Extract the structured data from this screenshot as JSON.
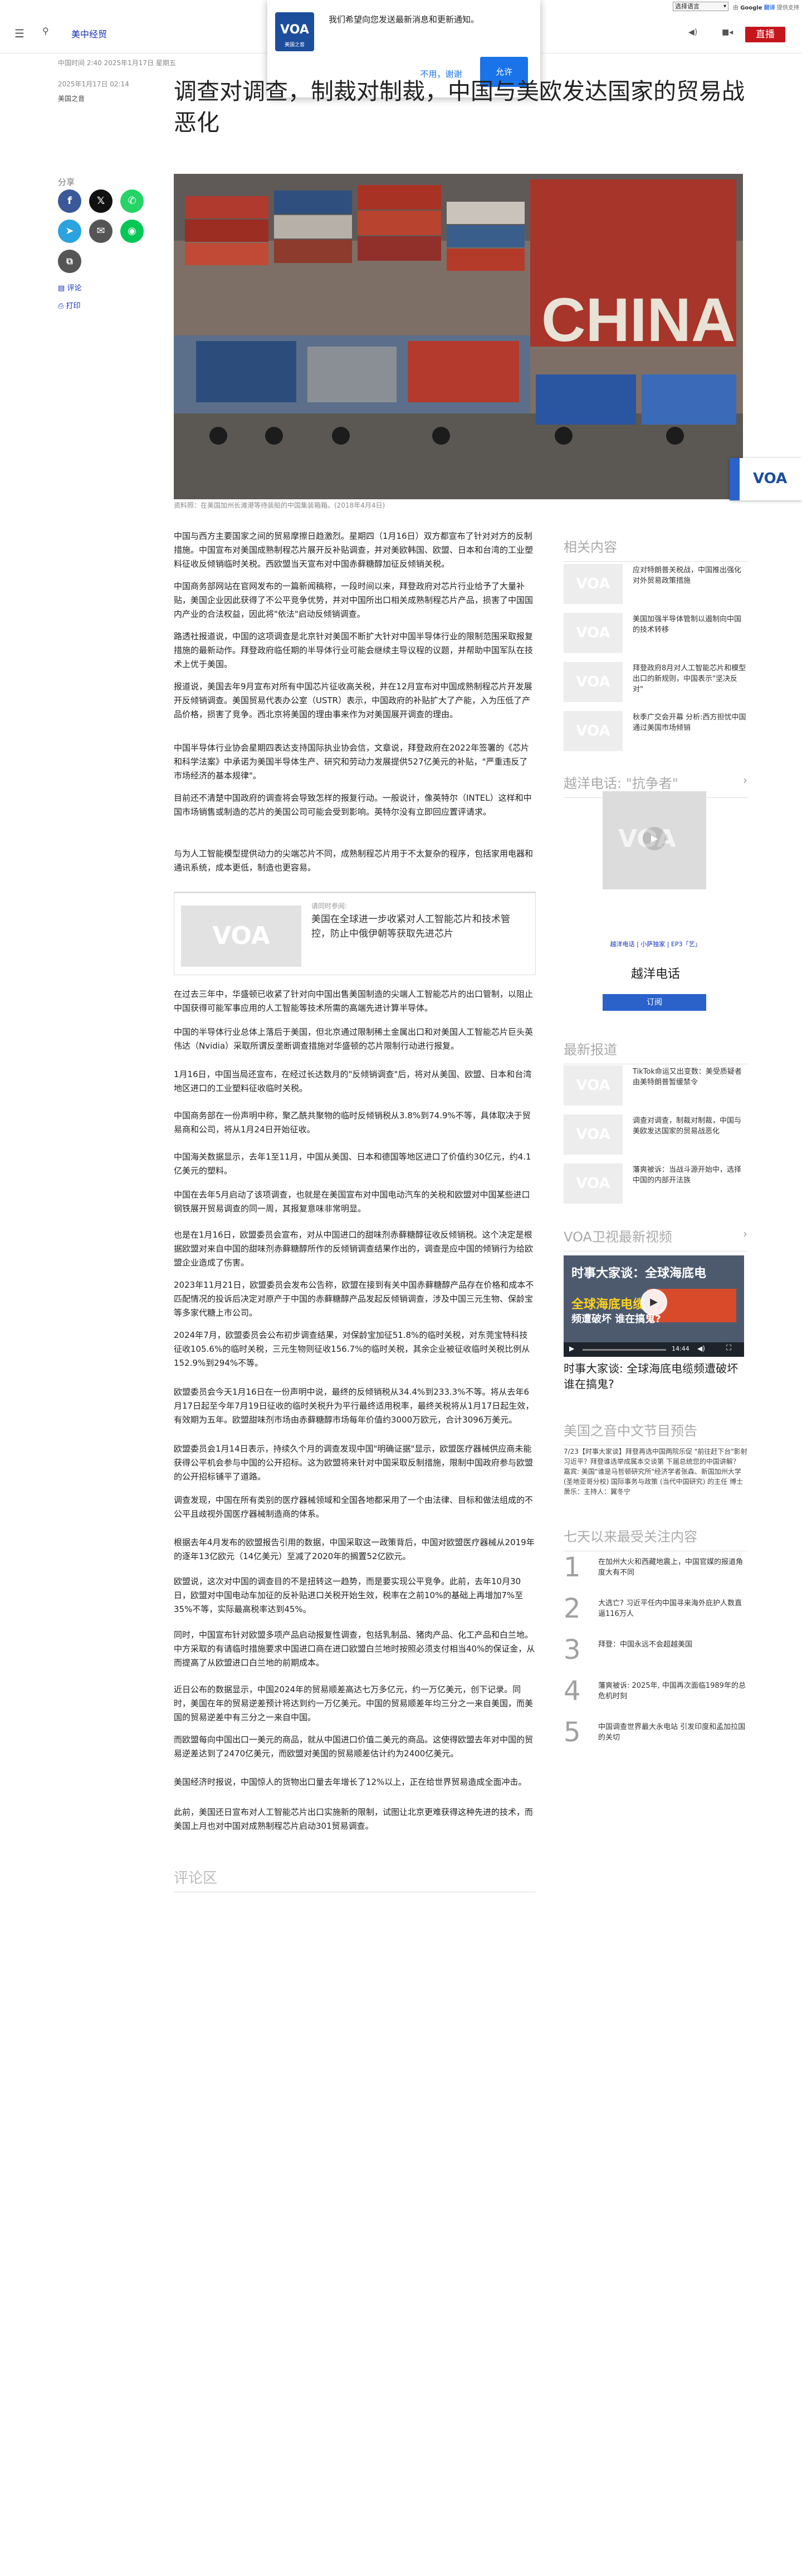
{
  "translate_bar": {
    "select_label": "选择语言",
    "powered": "由",
    "google": "Google",
    "translate": "翻译",
    "suffix": "提供支持"
  },
  "header": {
    "section": "美中经贸",
    "live": "直播"
  },
  "notification": {
    "message": "我们希望向您发送最新消息和更新通知。",
    "deny": "不用，谢谢",
    "allow": "允许",
    "logo_text": "VOA",
    "logo_sub": "美国之音"
  },
  "article": {
    "dateline": "中国时间 2:40 2025年1月17日 星期五",
    "date": "2025年1月17日 02:14",
    "author": "美国之音",
    "headline": "调查对调查，制裁对制裁，中国与美欧发达国家的贸易战恶化",
    "caption": "资料照：在美国加州长滩港等待装船的中国集装箱箱。(2018年4月4日)",
    "paragraphs": [
      "中国与西方主要国家之间的贸易摩擦日趋激烈。星期四（1月16日）双方都宣布了针对对方的反制措施。中国宣布对美国成熟制程芯片展开反补贴调查，并对美欧韩国、欧盟、日本和台湾的工业塑料征收反倾销临时关税。西欧盟当天宣布对中国赤藓糖醇加征反倾销关税。",
      "中国商务部网站在官网发布的一篇新闻稿称，一段时间以来，拜登政府对芯片行业给予了大量补贴，美国企业因此获得了不公平竞争优势，并对中国所出口相关成熟制程芯片产品，损害了中国国内产业的合法权益，因此将\"依法\"启动反倾销调查。",
      "路透社报道说，中国的这项调查是北京针对美国不断扩大针对中国半导体行业的限制范围采取报复措施的最新动作。拜登政府临任期的半导体行业可能会继续主导议程的议题，并帮助中国军队在技术上优于美国。",
      "报道说，美国去年9月宣布对所有中国芯片征收高关税，并在12月宣布对中国成熟制程芯片开发展开反倾销调查。美国贸易代表办公室（USTR）表示，中国政府的补贴扩大了产能，入为压低了产品价格，损害了竞争。西北京将美国的理由事来作为对美国展开调查的理由。",
      "中国半导体行业协会星期四表达支持国际执业协会信，文章说，拜登政府在2022年签署的《芯片和科学法案》中承诺为美国半导体生产、研究和劳动力发展提供527亿美元的补贴，\"严重违反了市场经济的基本规律\"。",
      "目前还不清楚中国政府的调查将会导致怎样的报复行动。一般说计，像英特尔（INTEL）这样和中国市场销售或制造的芯片的美国公司可能会受到影响。英特尔没有立即回应置评请求。",
      "与为人工智能模型提供动力的尖端芯片不同，成熟制程芯片用于不太复杂的程序，包括家用电器和通讯系统，成本更低，制造也更容易。",
      "在过去三年中，华盛顿已收紧了针对向中国出售美国制造的尖端人工智能芯片的出口管制，以阻止中国获得可能军事应用的人工智能等技术所需的高端先进计算半导体。",
      "中国的半导体行业总体上落后于美国，但北京通过限制稀土金属出口和对美国人工智能芯片巨头英伟达（Nvidia）采取所谓反垄断调查措施对华盛顿的芯片限制行动进行报复。",
      "1月16日，中国当局还宣布，在经过长达数月的\"反倾销调查\"后，将对从美国、欧盟、日本和台湾地区进口的工业塑料征收临时关税。",
      "中国商务部在一份声明中称，聚乙酰共聚物的临时反倾销税从3.8%到74.9%不等，具体取决于贸易商和公司，将从1月24日开始征收。",
      "中国海关数据显示，去年1至11月，中国从美国、日本和德国等地区进口了价值约30亿元，约4.1亿美元的塑料。",
      "中国在去年5月启动了该项调查，也就是在美国宣布对中国电动汽车的关税和欧盟对中国某些进口钢铁展开贸易调查的同一周，其报复意味非常明显。",
      "也是在1月16日，欧盟委员会宣布，对从中国进口的甜味剂赤藓糖醇征收反倾销税。这个决定是根据欧盟对来自中国的甜味剂赤藓糖醇所作的反倾销调查结果作出的，调查是应中国的倾销行为给欧盟企业造成了伤害。",
      "2023年11月21日，欧盟委员会发布公告称，欧盟在接到有关中国赤藓糖醇产品存在价格和成本不匹配情况的投诉后决定对原产于中国的赤藓糖醇产品发起反倾销调查，涉及中国三元生物、保龄宝等多家代糖上市公司。",
      "2024年7月，欧盟委员会公布初步调查结果，对保龄宝加征51.8%的临时关税，对东莞宝特科技征收105.6%的临时关税，三元生物则征收156.7%的临时关税，其余企业被征收临时关税比例从152.9%到294%不等。",
      "欧盟委员会今天1月16日在一份声明中说，最终的反倾销税从34.4%到233.3%不等。将从去年6月17日起至今年7月19日征收的临时关税升为平行最终适用税率，最终关税将从1月17日起生效，有效期为五年。欧盟甜味剂市场由赤藓糖醇市场每年价值约3000万欧元，合计3096万美元。",
      "欧盟委员会1月14日表示，持续久个月的调查发现中国\"明确证据\"显示，欧盟医疗器械供应商未能获得公平机会参与中国的公开招标。这为欧盟将来针对中国采取反制措施，限制中国政府参与欧盟的公开招标铺平了道路。",
      "调查发现，中国在所有类别的医疗器械领域和全国各地都采用了一个由法律、目标和做法组成的不公平且歧视外国医疗器械制造商的体系。",
      "根据去年4月发布的欧盟报告引用的数据，中国采取这一政策背后，中国对欧盟医疗器械从2019年的逐年13亿欧元（14亿美元）至减了2020年的搁置52亿欧元。",
      "欧盟说，这次对中国的调查目的不是扭转这一趋势，而是要实现公平竞争。此前，去年10月30日，欧盟对中国电动车加征的反补贴进口关税开始生效，税率在之前10%的基础上再增加7%至35%不等，实际最高税率达到45%。",
      "同时，中国宣布针对欧盟多项产品启动报复性调查，包括乳制品、猪肉产品、化工产品和白兰地。中方采取的有请临时措施要求中国进口商在进口欧盟白兰地时按照必须支付相当40%的保证金，从而提高了从欧盟进口白兰地的前期成本。",
      "近日公布的数据显示，中国2024年的贸易顺差高达七万多亿元，约一万亿美元，创下记录。同时，美国在年的贸易逆差预计将达到约一万亿美元。中国的贸易顺差年均三分之一来自美国，而美国的贸易逆差中有三分之一来自中国。",
      "而欧盟每向中国出口一美元的商品，就从中国进口价值二美元的商品。这使得欧盟去年对中国的贸易逆差达到了2470亿美元，而欧盟对美国的贸易顺差估计约为2400亿美元。",
      "美国经济时报说，中国惊人的货物出口量去年增长了12%以上，正在给世界贸易造成全面冲击。",
      "此前，美国还日宣布对人工智能芯片出口实施新的限制，试图让北京更难获得这种先进的技术，而美国上月也对中国对成熟制程芯片启动301贸易调查。"
    ],
    "related_inline": {
      "label": "请同时参阅:",
      "title": "美国在全球进一步收紧对人工智能芯片和技术管控，防止中俄伊朝等获取先进芯片"
    },
    "comments": "评论区"
  },
  "share": {
    "label": "分享",
    "comment": "评论",
    "print": "打印"
  },
  "sidebar": {
    "related_title": "相关内容",
    "related": [
      "应对特朗普关税战，中国推出强化对外贸易政策措施",
      "美国加强半导体管制以遏制向中国的技术转移",
      "拜登政府8月对人工智能芯片和模型出口的新规则，中国表示\"坚决反对\"",
      "秋季广交会开幕 分析:西方担忧中国通过美国市场倾销"
    ],
    "podcast_title": "越洋电话: \"抗争者\"",
    "podcast_links": [
      "越洋电话",
      "小萨独家",
      "EP3「艺」"
    ],
    "podcast_name": "越洋电话",
    "subscribe": "订阅",
    "latest_title": "最新报道",
    "latest": [
      "TikTok命运又出变数：美受质疑者由美特朗普暂缓禁令",
      "调查对调查，制裁对制裁，中国与美欧发达国家的贸易战恶化",
      "藩爽被诉：当战斗源开始中，选择中国的内部开法族"
    ],
    "video_title": "VOA卫视最新视频",
    "video_overlay_1": "时事大家谈：全球海底电",
    "video_overlay_2": "全球海底电缆",
    "video_overlay_3": "频遭破坏 谁在搞鬼?",
    "video_time": "14:44",
    "video_caption": "时事大家谈: 全球海底电缆频遭破坏 谁在搞鬼?",
    "preview_title": "美国之音中文节目预告",
    "preview_text": "7/23【时事大家谈】拜登再选中国两院乐促 \"前往赶下台\"影射习近平？拜登谁选举成属本交谈第 下届总统您的中国讲解？ 嘉宾: 美国\"谁是马哲顿研究所\"经济学者张森、新国加州大学 (圣地亚哥分校) 国际事务与政策 (当代中国研究) 的主任 博士 萧乐：主持人：翼冬宁",
    "popular_title": "七天以来最受关注内容",
    "popular": [
      {
        "num": "1",
        "text": "在加州大火和西藏地震上，中国官媒的报道角度大有不同"
      },
      {
        "num": "2",
        "text": "大选亡? 习近平任内中国寻来海外庇护人数直逼116万人"
      },
      {
        "num": "3",
        "text": "拜登：中国永远不会超越美国"
      },
      {
        "num": "4",
        "text": "藩爽被诉: 2025年, 中国再次面临1989年的总危机时刻"
      },
      {
        "num": "5",
        "text": "中国调查世界最大永电站 引发印度和孟加拉国的关切"
      }
    ]
  },
  "colors": {
    "accent": "#1330bf",
    "live": "#c4161c",
    "allow": "#1a73e8"
  }
}
